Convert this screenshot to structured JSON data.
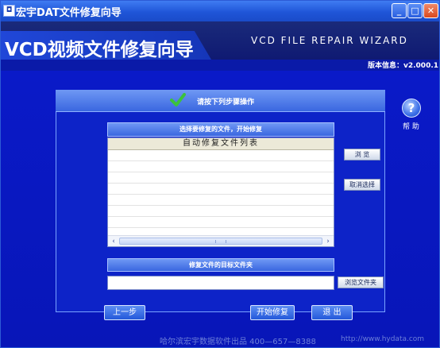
{
  "window": {
    "icon_glyph": "◘",
    "title": "宏宇DAT文件修复向导",
    "minimize_glyph": "_",
    "maximize_glyph": "□",
    "close_glyph": "✕"
  },
  "header": {
    "main_title": "VCD视频文件修复向导",
    "en_title": "VCD FILE REPAIR WIZARD",
    "version": "版本信息：v2.000.1"
  },
  "panel": {
    "title": "请按下列步骤操作",
    "check_icon": "check-icon"
  },
  "help": {
    "glyph": "?",
    "label": "帮 助"
  },
  "file_list": {
    "section_title": "选择要修复的文件，开始修复",
    "column_header": "自动修复文件列表",
    "rows": []
  },
  "buttons": {
    "browse": "浏  览",
    "cancel_select": "取消选择",
    "browse_folder": "浏览文件夹",
    "prev": "上一步",
    "start": "开始修复",
    "exit": "退  出"
  },
  "target": {
    "section_title": "修复文件的目标文件夹",
    "value": ""
  },
  "scrollbar": {
    "left_glyph": "‹",
    "right_glyph": "›"
  },
  "footer": {
    "company": "哈尔滨宏宇数据软件出品  400—657—8388",
    "url": "http://www.hydata.com"
  },
  "colors": {
    "background": "#0a1ac8",
    "accent": "#3a67e0",
    "check": "#3cc23c"
  }
}
